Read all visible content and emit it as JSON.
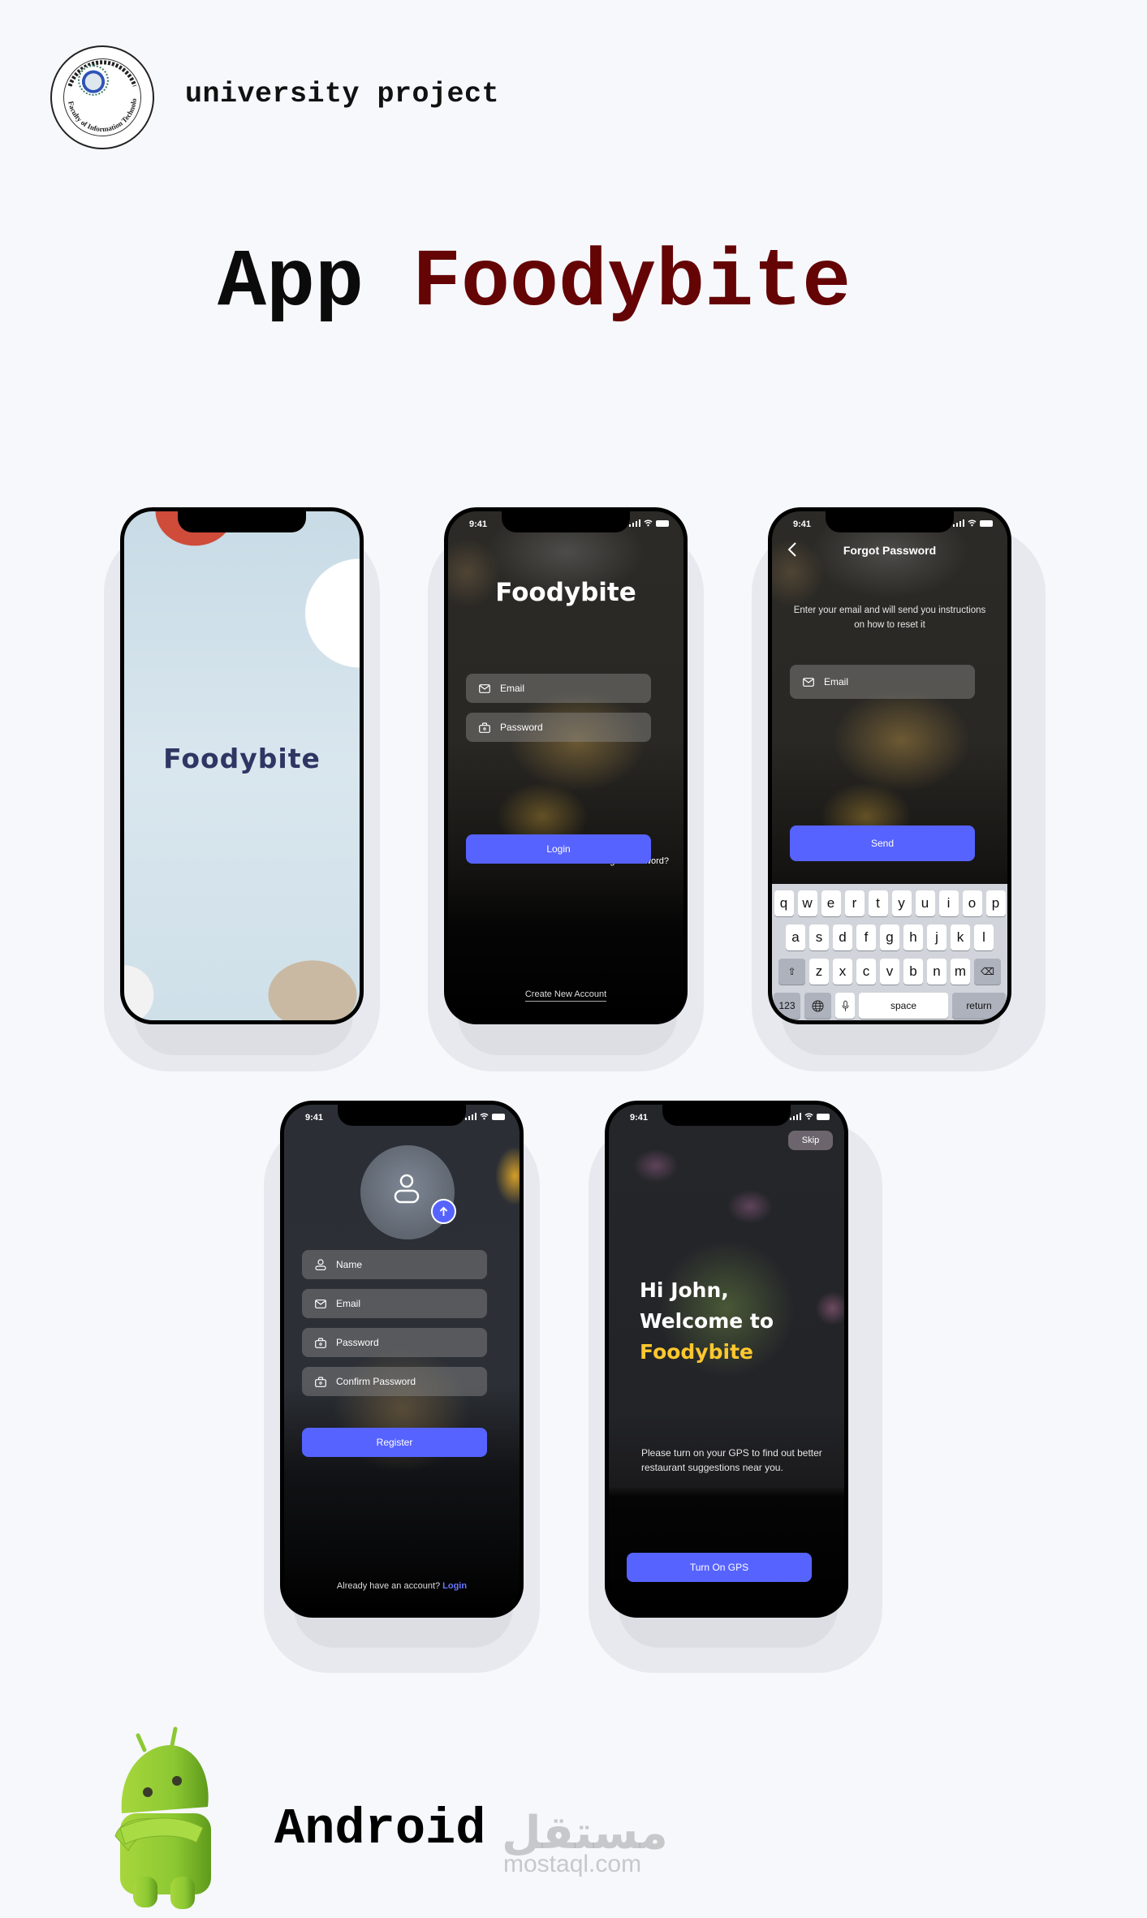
{
  "header": {
    "logo_alt": "Faculty of Information Technology",
    "logo_caption": "Faculty of Information Technology",
    "subtitle": "university project"
  },
  "title": {
    "prefix": "App",
    "brand": "Foodybite",
    "prefix_color": "#0b0b0b",
    "brand_color": "#650405"
  },
  "colors": {
    "page_bg": "#f6f8fc",
    "accent": "#5663ff",
    "welcome_brand": "#fdc72f",
    "splash_brand": "#303663"
  },
  "status_bar": {
    "time": "9:41"
  },
  "screens": {
    "splash": {
      "brand": "Foodybite"
    },
    "login": {
      "brand": "Foodybite",
      "email_placeholder": "Email",
      "password_placeholder": "Password",
      "forgot_link": "Forgot Password?",
      "login_button": "Login",
      "create_account_link": "Create New Account"
    },
    "forgot_password": {
      "title": "Forgot Password",
      "description": "Enter your email and will send you instructions on how to reset it",
      "email_placeholder": "Email",
      "send_button": "Send",
      "keyboard": {
        "row1": [
          "q",
          "w",
          "e",
          "r",
          "t",
          "y",
          "u",
          "i",
          "o",
          "p"
        ],
        "row2": [
          "a",
          "s",
          "d",
          "f",
          "g",
          "h",
          "j",
          "k",
          "l"
        ],
        "row3": [
          "z",
          "x",
          "c",
          "v",
          "b",
          "n",
          "m"
        ],
        "numbers_key": "123",
        "space_key": "space",
        "return_key": "return"
      }
    },
    "register": {
      "name_placeholder": "Name",
      "email_placeholder": "Email",
      "password_placeholder": "Password",
      "confirm_password_placeholder": "Confirm Password",
      "register_button": "Register",
      "already_text": "Already have an account?",
      "login_link": "Login"
    },
    "welcome": {
      "skip_button": "Skip",
      "greeting_line1": "Hi John,",
      "greeting_line2": "Welcome to",
      "brand": "Foodybite",
      "description": "Please turn on your GPS to find out better restaurant suggestions near you.",
      "gps_button": "Turn On GPS"
    }
  },
  "footer": {
    "platform": "Android",
    "watermark_ar": "مستقل",
    "watermark_en": "mostaql.com"
  }
}
